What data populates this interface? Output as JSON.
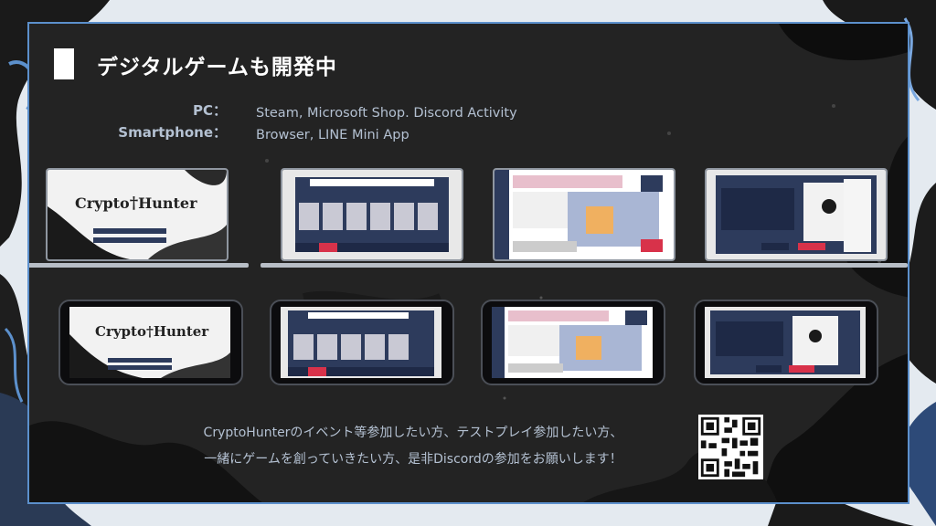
{
  "title": "デジタルゲームも開発中",
  "platforms": [
    {
      "label": "PC：",
      "value": "Steam, Microsoft Shop. Discord Activity"
    },
    {
      "label": "Smartphone：",
      "value": "Browser, LINE Mini App"
    }
  ],
  "game": {
    "logo_left": "Crypto",
    "logo_right": "Hunter"
  },
  "message": {
    "line1": "CryptoHunterのイベント等参加したい方、テストプレイ参加したい方、",
    "line2": "一緒にゲームを創っていきたい方、是非Discordの参加をお願いします！"
  },
  "colors": {
    "accent": "#5c90cc",
    "panel": "#232323",
    "text": "#b4c1d2",
    "ui_navy": "#2d3b5c",
    "ui_red": "#d8324a",
    "ui_pink": "#e8bfcc"
  },
  "icons": [
    "laptop-icon",
    "smartphone-icon",
    "qr-code-icon"
  ]
}
